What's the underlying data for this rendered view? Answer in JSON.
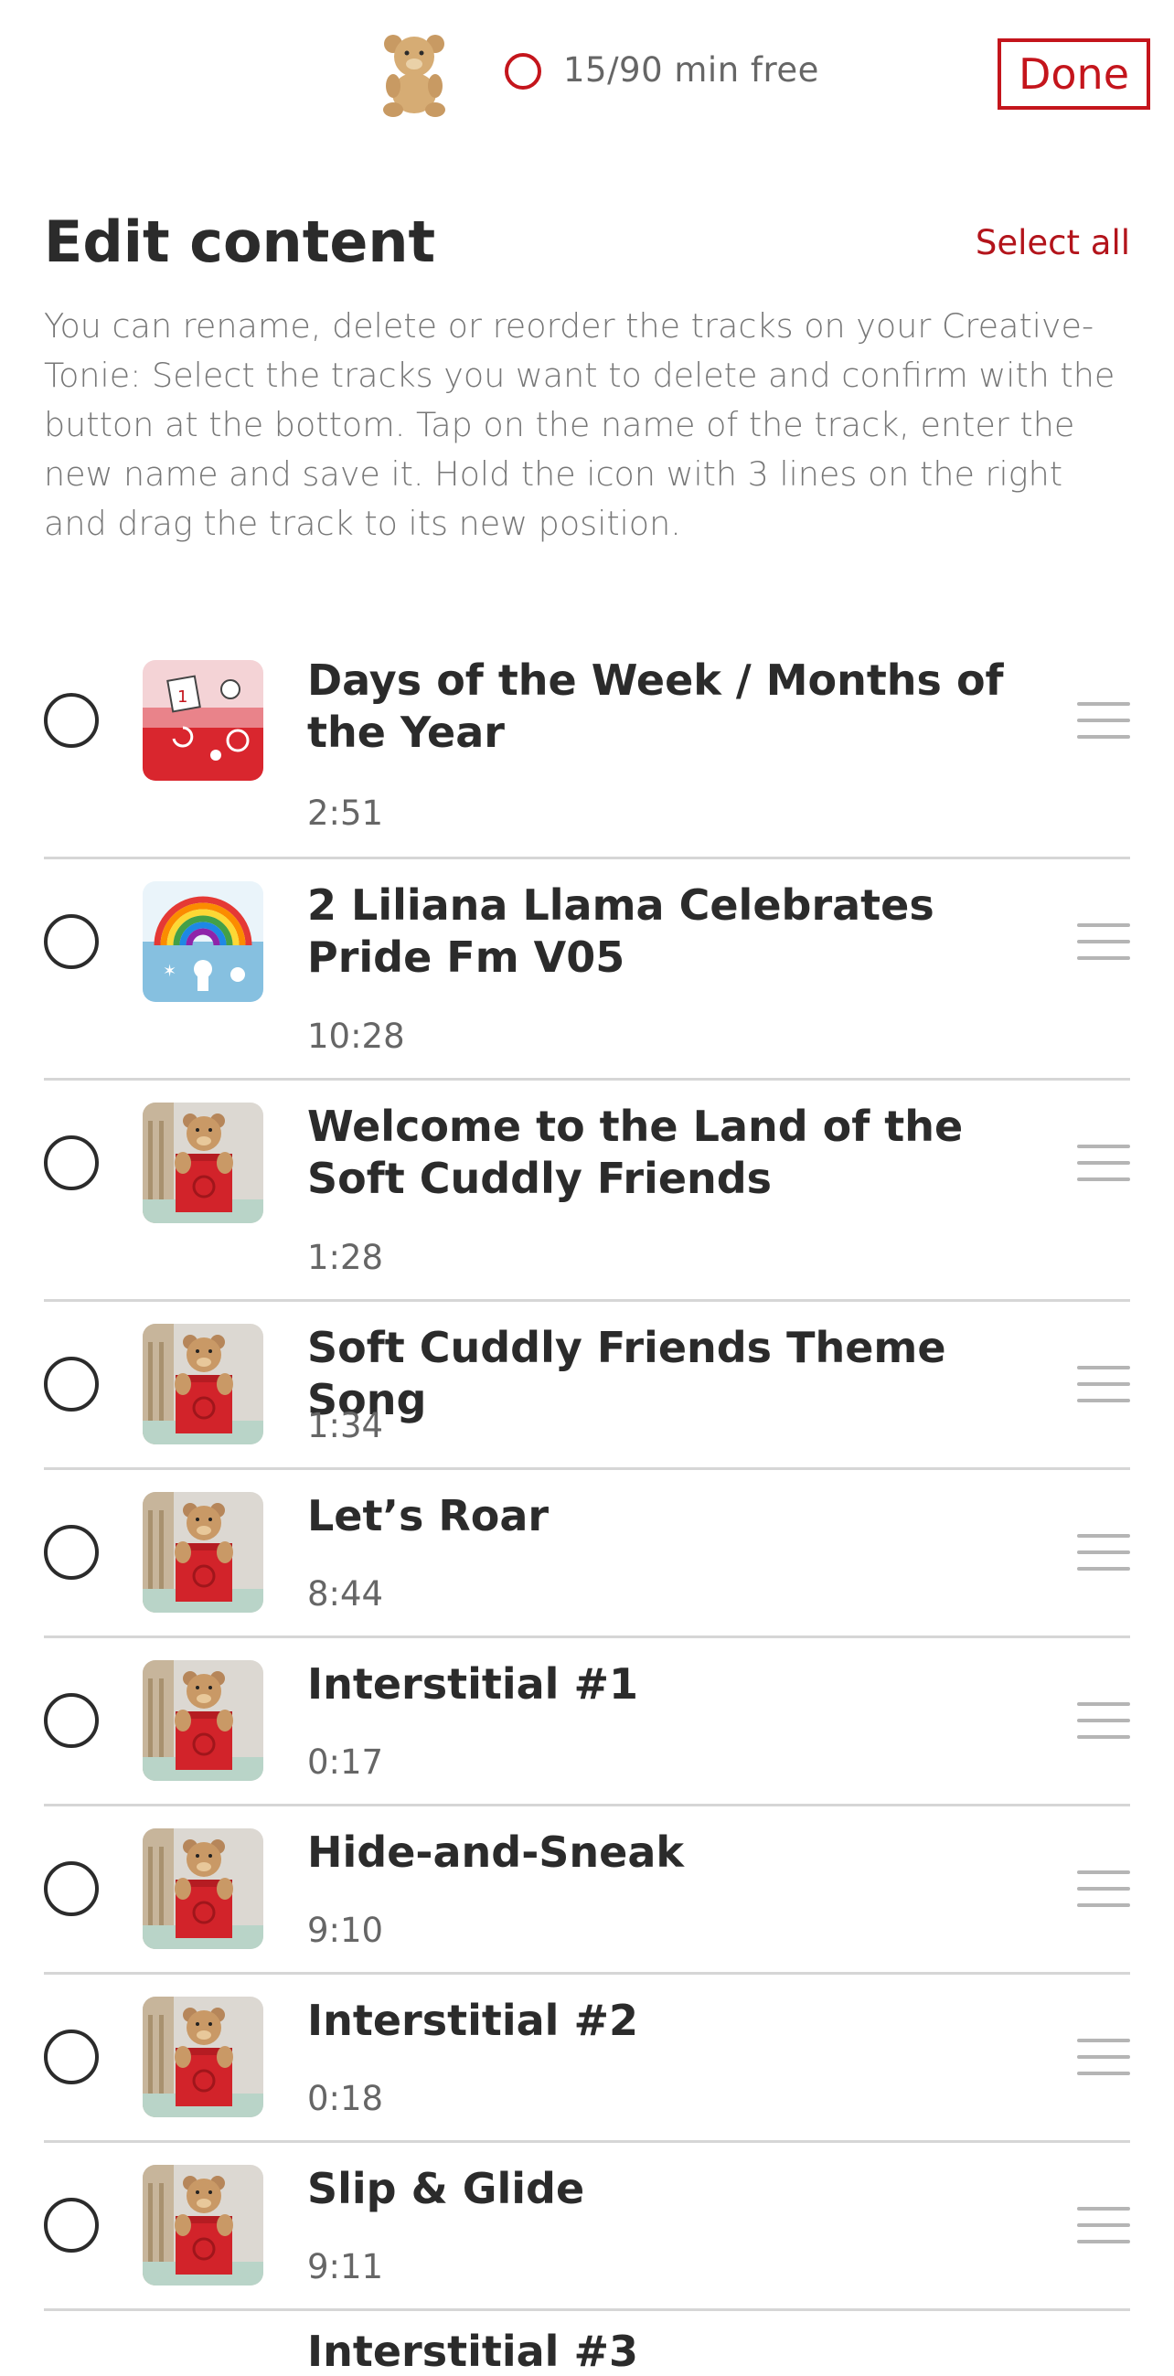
{
  "header": {
    "usage_text": "15/90 min free",
    "done_label": "Done"
  },
  "page": {
    "title": "Edit content",
    "select_all_label": "Select all",
    "instructions": "You can rename, delete or reorder the tracks on your Creative-Tonie: Select the tracks you want to delete and confirm with the button at the bottom. Tap on the name of the track, enter the new name and save it. Hold the icon with 3 lines on the right and drag the track to its new position."
  },
  "tracks": [
    {
      "title": "Days of the Week / Months of the Year",
      "duration": "2:51",
      "thumb": "calendar-thumb"
    },
    {
      "title": "2 Liliana Llama Celebrates Pride Fm V05",
      "duration": "10:28",
      "thumb": "rainbow-thumb"
    },
    {
      "title": "Welcome to the Land of the Soft Cuddly Friends",
      "duration": "1:28",
      "thumb": "teddy-box-thumb"
    },
    {
      "title": "Soft Cuddly Friends Theme Song",
      "duration": "1:34",
      "thumb": "teddy-box-thumb"
    },
    {
      "title": "Let’s Roar",
      "duration": "8:44",
      "thumb": "teddy-box-thumb"
    },
    {
      "title": "Interstitial #1",
      "duration": "0:17",
      "thumb": "teddy-box-thumb"
    },
    {
      "title": "Hide-and-Sneak",
      "duration": "9:10",
      "thumb": "teddy-box-thumb"
    },
    {
      "title": "Interstitial #2",
      "duration": "0:18",
      "thumb": "teddy-box-thumb"
    },
    {
      "title": "Slip & Glide",
      "duration": "9:11",
      "thumb": "teddy-box-thumb"
    }
  ],
  "partial_track_title": "Interstitial #3",
  "colors": {
    "accent": "#c4151c",
    "divider": "#d6d6d6",
    "handle": "#b5b5b5"
  }
}
